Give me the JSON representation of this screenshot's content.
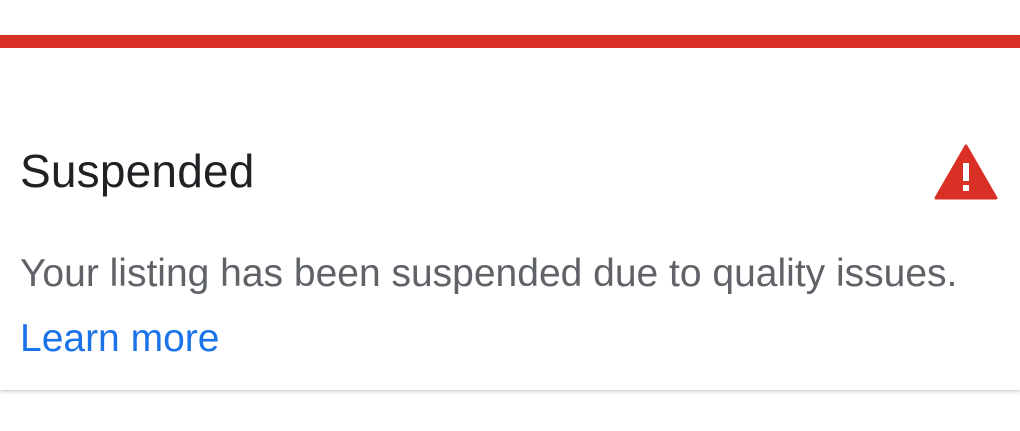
{
  "status_card": {
    "title": "Suspended",
    "message": "Your listing has been suspended due to quality issues.",
    "link_label": "Learn more",
    "icon": "warning-triangle-icon"
  },
  "colors": {
    "accent": "#d93025",
    "link": "#1a73e8",
    "title": "#202124",
    "body_text": "#5f6368"
  }
}
